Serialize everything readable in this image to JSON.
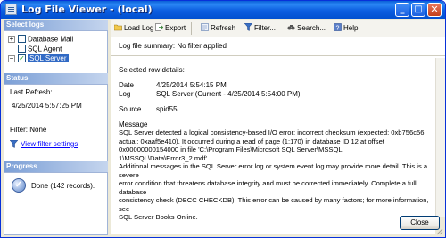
{
  "window": {
    "title": "Log File Viewer - (local)",
    "close_button": "Close"
  },
  "select_logs": {
    "header": "Select logs",
    "items": [
      {
        "label": "Database Mail",
        "expander": "+",
        "checked": false,
        "selected": false
      },
      {
        "label": "SQL Agent",
        "expander": "",
        "checked": false,
        "selected": false
      },
      {
        "label": "SQL Server",
        "expander": "−",
        "checked": true,
        "selected": true
      }
    ]
  },
  "status": {
    "header": "Status",
    "last_refresh_label": "Last Refresh:",
    "last_refresh_value": "4/25/2014 5:57:25 PM",
    "filter": "Filter: None",
    "view_filter_link": "View filter settings"
  },
  "progress": {
    "header": "Progress",
    "text": "Done (142 records)."
  },
  "toolbar": {
    "load_log": "Load Log",
    "export": "Export",
    "refresh": "Refresh",
    "filter": "Filter...",
    "search": "Search...",
    "help": "Help"
  },
  "summary": "Log file summary: No filter applied",
  "details": {
    "header": "Selected row details:",
    "date_label": "Date",
    "date_value": "4/25/2014 5:54:15 PM",
    "log_label": "Log",
    "log_value": "SQL Server (Current - 4/25/2014 5:54:00 PM)",
    "source_label": "Source",
    "source_value": "spid55",
    "message_label": "Message",
    "message_lines": [
      "SQL Server detected a logical consistency-based I/O error: incorrect checksum (expected: 0xb756c56;",
      "actual: 0xaaf5e410). It occurred during a read of page (1:170) in database ID 12 at offset",
      "0x00000000154000 in file 'C:\\Program Files\\Microsoft SQL Server\\MSSQL 1\\MSSQL\\Data\\Error3_2.mdf'.",
      "Additional messages in the SQL Server error log or system event log may provide more detail. This is a severe",
      "error condition that threatens database integrity and must be corrected immediately. Complete a full database",
      "consistency check (DBCC CHECKDB). This error can be caused by many factors; for more information, see",
      "SQL Server Books Online."
    ]
  },
  "colors": {
    "title_bar": "#0a5fd8",
    "section_header": "#7b9fd6",
    "selection": "#316ac5",
    "link": "#0000ff"
  }
}
